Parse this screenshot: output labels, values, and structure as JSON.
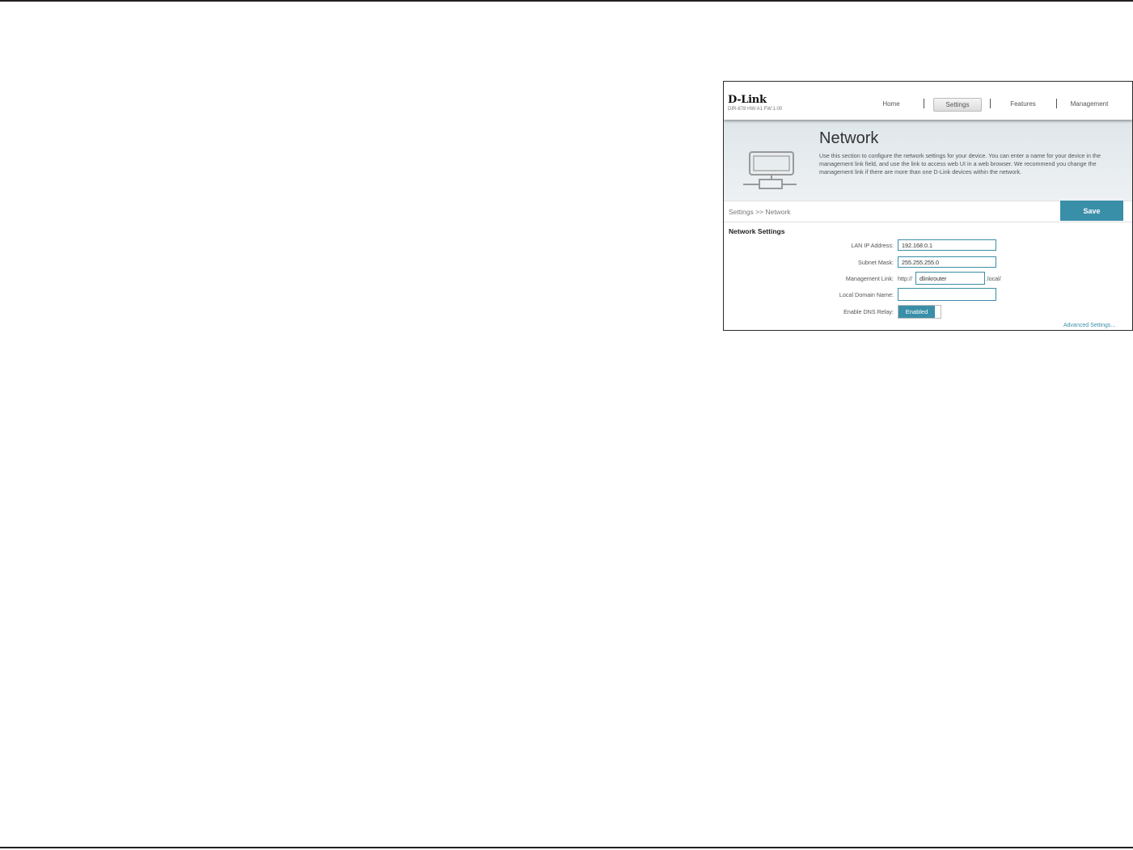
{
  "header": {
    "brand": "D-Link",
    "model_info": "DIR-878 HW:A1 FW:1.00",
    "nav": [
      "Home",
      "Settings",
      "Features",
      "Management"
    ],
    "active_nav": "Settings"
  },
  "banner": {
    "title": "Network",
    "description": "Use this section to configure the network settings for your device. You can enter a name for your device in the management link field, and use the link to access web UI in a web browser. We recommend you change the management link if there are more than one D-Link devices within the network."
  },
  "breadcrumb": "Settings >> Network",
  "save_label": "Save",
  "section_title": "Network Settings",
  "fields": {
    "lan_ip": {
      "label": "LAN IP Address:",
      "value": "192.168.0.1"
    },
    "subnet": {
      "label": "Subnet Mask:",
      "value": "255.255.255.0"
    },
    "mgmt": {
      "label": "Management Link:",
      "prefix": "http://",
      "value": "dlinkrouter",
      "suffix": ".local/"
    },
    "domain": {
      "label": "Local Domain Name:",
      "value": ""
    },
    "dns_relay": {
      "label": "Enable DNS Relay:",
      "value": "Enabled"
    }
  },
  "advanced_link": "Advanced Settings...",
  "colors": {
    "accent": "#3a8fa8",
    "rule": "#231f20"
  },
  "icons": {
    "network": "network-computer-icon"
  }
}
